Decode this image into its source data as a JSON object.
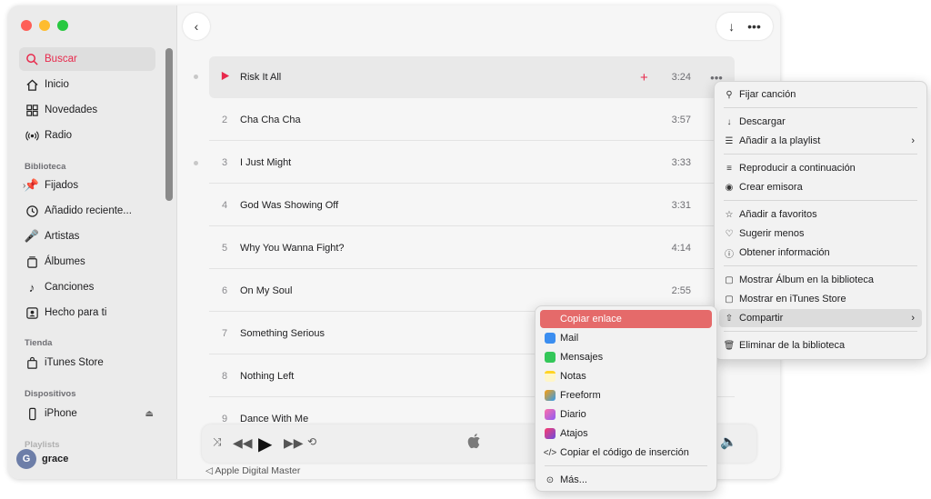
{
  "sidebar": {
    "items": [
      {
        "label": "Buscar",
        "icon": "search-icon"
      },
      {
        "label": "Inicio",
        "icon": "home-icon"
      },
      {
        "label": "Novedades",
        "icon": "grid-icon"
      },
      {
        "label": "Radio",
        "icon": "radio-icon"
      }
    ],
    "library_title": "Biblioteca",
    "library": [
      {
        "label": "Fijados",
        "icon": "pin-icon"
      },
      {
        "label": "Añadido reciente...",
        "icon": "clock-icon"
      },
      {
        "label": "Artistas",
        "icon": "microphone-icon"
      },
      {
        "label": "Álbumes",
        "icon": "album-icon"
      },
      {
        "label": "Canciones",
        "icon": "music-note-icon"
      },
      {
        "label": "Hecho para ti",
        "icon": "person-icon"
      }
    ],
    "store_title": "Tienda",
    "store": [
      {
        "label": "iTunes Store",
        "icon": "bag-icon"
      }
    ],
    "devices_title": "Dispositivos",
    "devices": [
      {
        "label": "iPhone",
        "icon": "iphone-icon"
      }
    ],
    "playlists_title": "Playlists",
    "user": {
      "initial": "G",
      "name": "grace"
    }
  },
  "tracks": [
    {
      "num": "",
      "title": "Risk It All",
      "duration": "3:24",
      "playing": true
    },
    {
      "num": "2",
      "title": "Cha Cha Cha",
      "duration": "3:57"
    },
    {
      "num": "3",
      "title": "I Just Might",
      "duration": "3:33"
    },
    {
      "num": "4",
      "title": "God Was Showing Off",
      "duration": "3:31"
    },
    {
      "num": "5",
      "title": "Why You Wanna Fight?",
      "duration": "4:14"
    },
    {
      "num": "6",
      "title": "On My Soul",
      "duration": "2:55"
    },
    {
      "num": "7",
      "title": "Something Serious",
      "duration": ""
    },
    {
      "num": "8",
      "title": "Nothing Left",
      "duration": ""
    },
    {
      "num": "9",
      "title": "Dance With Me",
      "duration": ""
    }
  ],
  "player": {
    "master_label": "Apple Digital Master"
  },
  "context_menu": {
    "items": [
      {
        "label": "Fijar canción",
        "icon": "pin-icon"
      },
      {
        "label": "Descargar",
        "icon": "download-icon"
      },
      {
        "label": "Añadir a la playlist",
        "icon": "add-playlist-icon"
      },
      {
        "label": "Reproducir a continuación",
        "icon": "play-next-icon"
      },
      {
        "label": "Crear emisora",
        "icon": "station-icon"
      },
      {
        "label": "Añadir a favoritos",
        "icon": "star-icon"
      },
      {
        "label": "Sugerir menos",
        "icon": "thumbs-down-icon"
      },
      {
        "label": "Obtener información",
        "icon": "info-icon"
      },
      {
        "label": "Mostrar Álbum en la biblioteca",
        "icon": "album-icon"
      },
      {
        "label": "Mostrar en iTunes Store",
        "icon": "bag-icon"
      },
      {
        "label": "Compartir",
        "icon": "share-icon"
      },
      {
        "label": "Eliminar de la biblioteca",
        "icon": "trash-icon"
      }
    ]
  },
  "share_menu": {
    "items": [
      {
        "label": "Copiar enlace",
        "icon": "link-icon",
        "color": "#e56a6a"
      },
      {
        "label": "Mail",
        "icon": "mail-icon",
        "color": "#3b8ef0"
      },
      {
        "label": "Mensajes",
        "icon": "messages-icon",
        "color": "#34c759"
      },
      {
        "label": "Notas",
        "icon": "notes-icon",
        "color": "#ffd426"
      },
      {
        "label": "Freeform",
        "icon": "freeform-icon",
        "color": "#2f9bf0"
      },
      {
        "label": "Diario",
        "icon": "journal-icon",
        "color": "#8e5cf5"
      },
      {
        "label": "Atajos",
        "icon": "shortcuts-icon",
        "color": "#6a4ce0"
      },
      {
        "label": "Copiar el código de inserción",
        "icon": "code-icon"
      },
      {
        "label": "Más...",
        "icon": "more-icon"
      }
    ]
  },
  "colors": {
    "accent": "#e8294c"
  }
}
